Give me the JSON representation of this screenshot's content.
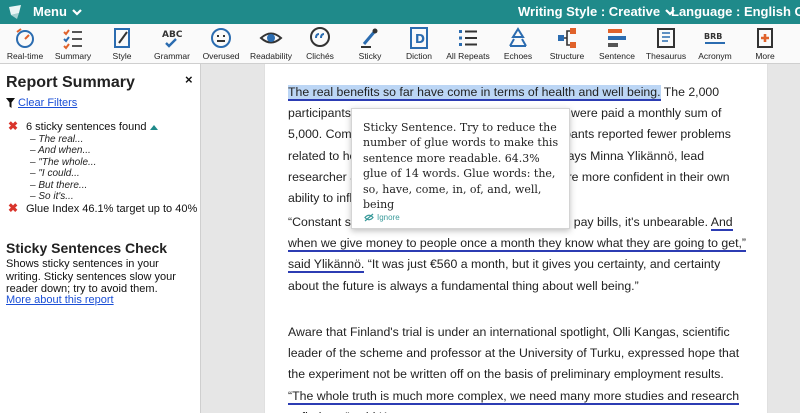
{
  "topbar": {
    "menu_label": "Menu",
    "writing_style": "Writing Style : Creative",
    "language": "Language : English Genera"
  },
  "toolbar": [
    {
      "name": "realtime",
      "label": "Real-time",
      "icon": "realtime-icon"
    },
    {
      "name": "summary",
      "label": "Summary",
      "icon": "summary-icon"
    },
    {
      "name": "style",
      "label": "Style",
      "icon": "style-icon"
    },
    {
      "name": "grammar",
      "label": "Grammar",
      "icon": "grammar-icon",
      "glyph": "ABC"
    },
    {
      "name": "overused",
      "label": "Overused",
      "icon": "overused-icon"
    },
    {
      "name": "readability",
      "label": "Readability",
      "icon": "eye-icon"
    },
    {
      "name": "cliches",
      "label": "Clichés",
      "icon": "quote-bubble-icon"
    },
    {
      "name": "sticky",
      "label": "Sticky",
      "icon": "sticky-icon"
    },
    {
      "name": "diction",
      "label": "Diction",
      "icon": "diction-icon",
      "glyph": "D"
    },
    {
      "name": "all-repeats",
      "label": "All Repeats",
      "icon": "list-icon"
    },
    {
      "name": "echoes",
      "label": "Echoes",
      "icon": "recycle-icon"
    },
    {
      "name": "structure",
      "label": "Structure",
      "icon": "structure-icon"
    },
    {
      "name": "sentence",
      "label": "Sentence",
      "icon": "sentence-icon"
    },
    {
      "name": "thesaurus",
      "label": "Thesaurus",
      "icon": "book-icon"
    },
    {
      "name": "acronym",
      "label": "Acronym",
      "icon": "acronym-icon",
      "glyph": "BRB"
    },
    {
      "name": "more",
      "label": "More",
      "icon": "plus-doc-icon"
    }
  ],
  "sidebar": {
    "title": "Report Summary",
    "close": "×",
    "clear_filters": "Clear Filters",
    "sticky_found": "6 sticky sentences found",
    "sticky_items": [
      "– The real...",
      "– And when...",
      "– \"The whole...",
      "– \"I could...",
      "– But there...",
      "– So it's..."
    ],
    "glue_index": "Glue Index 46.1% target up to 40%",
    "section_title": "Sticky Sentences Check",
    "section_desc": "Shows sticky sentences in your writing. Sticky sentences slow your reader down; try to avoid them.",
    "more_link": "More about this report"
  },
  "document": {
    "p1_highlight": "The real benefits so far have come in terms of health and well being.",
    "p1_rest": " The 2,000 participants were not required to seek out a job and were paid a monthly sum of 5,000. Compared with the control group, the participants reported fewer problems related to health, stress, mood and concentration, says Minna Ylikännö, lead researcher at Kela. Results also showed people were more confident in their own ability to influence it.",
    "p2_start": "“Constant stress about money and not being able to pay bills, it's unbearable. ",
    "p2_under": "And when we give money to people once a month they know what they are going to get,” said Ylikännö.",
    "p2_rest": " “It was just €560 a month, but it gives you certainty, and certainty about the future is always a fundamental thing about well being.”",
    "p3_start": "Aware that Finland's trial is under an international spotlight, Olli Kangas, scientific leader of the scheme and professor at the University of Turku, expressed hope that the experiment not be written off on the basis of preliminary employment results. ",
    "p3_under": "“The whole truth is much more complex, we need many more studies and research to find out,” said Kangas."
  },
  "popup": {
    "text": "Sticky Sentence. Try to reduce the number of glue words to make this sentence more readable. 64.3% glue of 14 words. Glue words: the, so, have, come, in, of, and, well, being",
    "ignore": "Ignore"
  },
  "colors": {
    "topbar": "#1f8a8a",
    "highlight": "#bcd6f5",
    "underline": "#2c3cb3",
    "error": "#d9342b",
    "link": "#1a4fd6"
  }
}
